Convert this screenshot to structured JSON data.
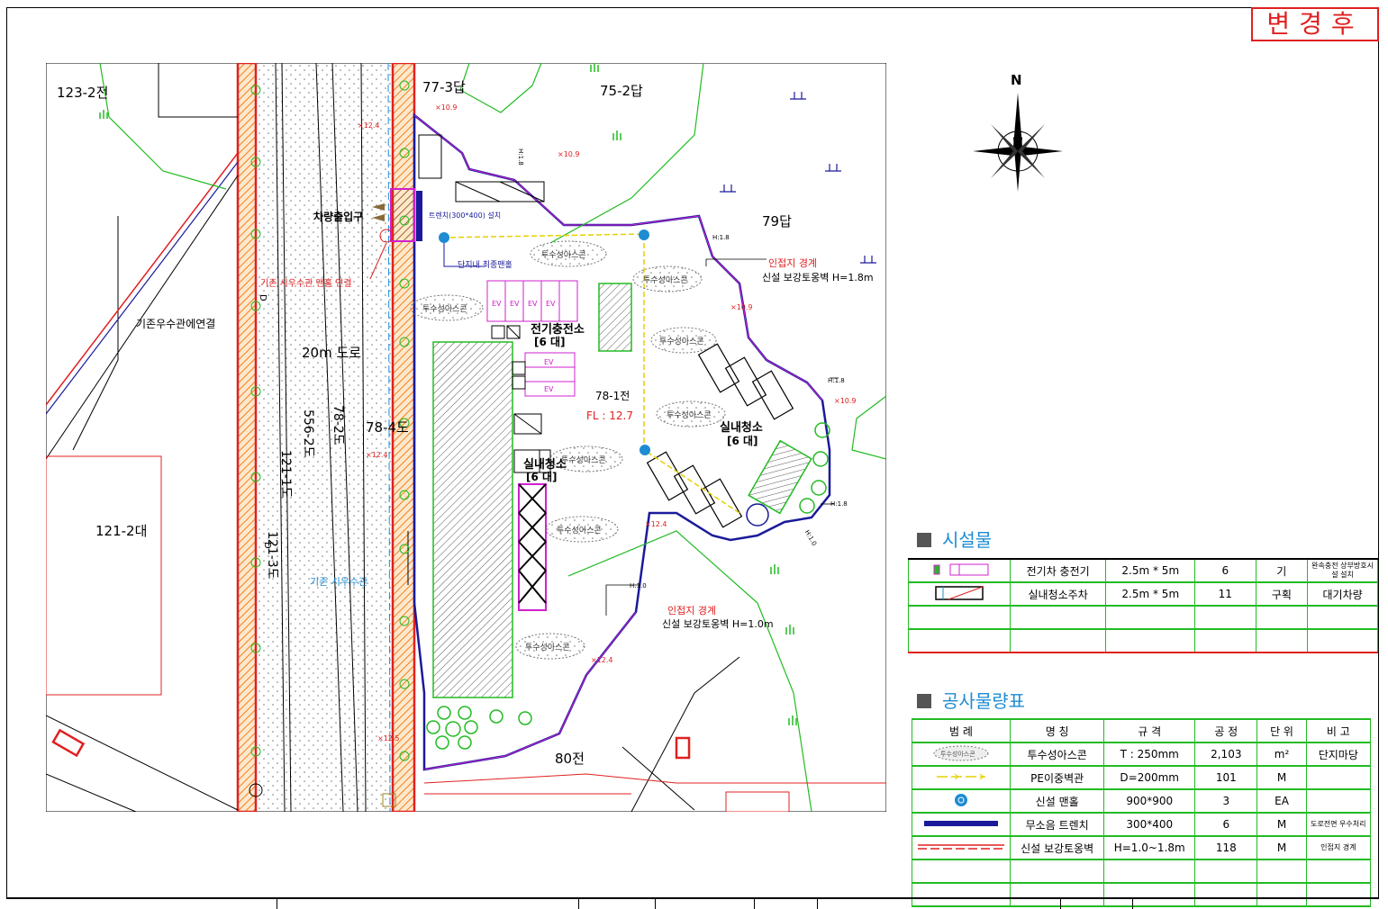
{
  "stamp": "변경후",
  "north": "N",
  "map_labels": {
    "parcel_123_2": "123-2전",
    "parcel_77_3": "77-3답",
    "parcel_75_2": "75-2답",
    "parcel_79": "79답",
    "parcel_121_2": "121-2대",
    "parcel_80": "80전",
    "parcel_78_1": "78-1전",
    "parcel_78_4": "78-4도",
    "parcel_78_2": "78-2도",
    "parcel_556_2": "556-2도",
    "parcel_121_1": "121-1도",
    "parcel_121_3": "121-3도",
    "fl": "FL : 12.7",
    "road": "20m 도로",
    "existing_drain": "기존우수관에연결",
    "existing_pipe": "기존 시우수관",
    "connect_pipe": "기존 시우수관 맨홀 연결",
    "entrance": "차량출입구",
    "trench_note": "트렌치(300*400) 설치",
    "final_manhole": "단지내 최종맨홀",
    "boundary1": "인접지 경계",
    "wall1": "신설 보강토옹벽 H=1.8m",
    "boundary2": "인접지 경계",
    "wall2": "신설 보강토옹벽 H=1.0m",
    "ev_station": "전기충전소",
    "ev_count": "[6 대]",
    "clean1": "실내청소",
    "clean1_count": "[6 대]",
    "clean2": "실내청소",
    "clean2_count": "[6 대]",
    "ascon": "투수성아스콘",
    "ev": "EV",
    "elev_109": "×10.9",
    "elev_124": "×12.4",
    "elev_125": "×12.5",
    "h18": "H:1.8",
    "h10": "H:1.0",
    "d": "D"
  },
  "facilities": {
    "title": "시설물",
    "rows": [
      {
        "name": "전기차 충전기",
        "spec": "2.5m * 5m",
        "qty": "6",
        "unit": "기",
        "note": "완속충전 상부방호시설 설치"
      },
      {
        "name": "실내청소주차",
        "spec": "2.5m * 5m",
        "qty": "11",
        "unit": "구획",
        "note": "대기차량"
      }
    ]
  },
  "quantities": {
    "title": "공사물량표",
    "headers": {
      "legend": "범 례",
      "name": "명 칭",
      "spec": "규 격",
      "qty": "공 정",
      "unit": "단 위",
      "note": "비 고"
    },
    "rows": [
      {
        "legend": "투수성아스콘",
        "name": "투수성아스콘",
        "spec": "T : 250mm",
        "qty": "2,103",
        "unit": "m²",
        "note": "단지마당"
      },
      {
        "legend": "pe-pipe",
        "name": "PE이중벽관",
        "spec": "D=200mm",
        "qty": "101",
        "unit": "M",
        "note": ""
      },
      {
        "legend": "manhole",
        "name": "신설 맨홀",
        "spec": "900*900",
        "qty": "3",
        "unit": "EA",
        "note": ""
      },
      {
        "legend": "trench",
        "name": "무소음 트렌치",
        "spec": "300*400",
        "qty": "6",
        "unit": "M",
        "note": "도로전면 우수처리"
      },
      {
        "legend": "retaining-wall",
        "name": "신설 보강토옹벽",
        "spec": "H=1.0~1.8m",
        "qty": "118",
        "unit": "M",
        "note": "인접지 경계"
      }
    ]
  },
  "colors": {
    "red": "#e02020",
    "green": "#22bb22",
    "blue": "#1e8cd2",
    "navy": "#1a1a9a",
    "magenta": "#d020d0",
    "orange": "#f08020"
  }
}
